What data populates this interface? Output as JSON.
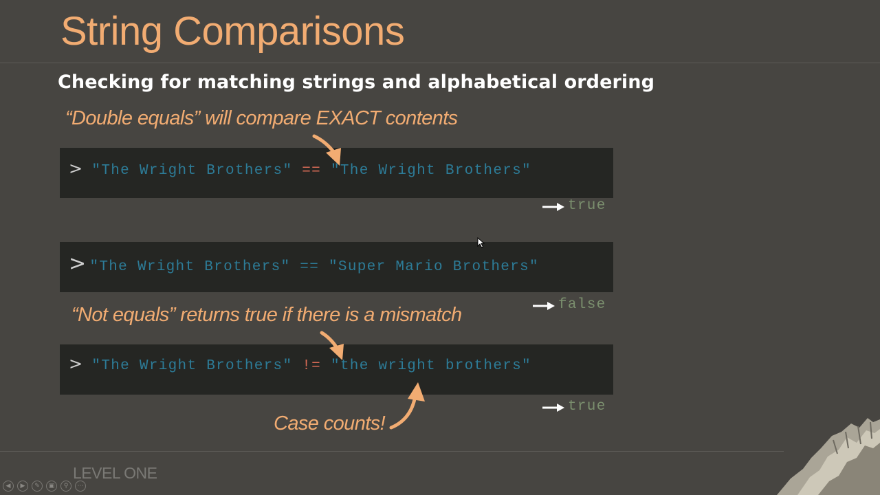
{
  "slide": {
    "title": "String Comparisons",
    "subtitle": "Checking for matching strings and alphabetical ordering",
    "footer_label": "LEVEL ONE",
    "accent_color": "#f2ac72",
    "background_color": "#474541",
    "code_background": "#252623"
  },
  "annotations": {
    "double_equals": "“Double equals” will compare EXACT contents",
    "not_equals": "“Not equals” returns true if there is a mismatch",
    "case_counts": "Case counts!"
  },
  "examples": [
    {
      "prompt": ">",
      "left": "\"The Wright Brothers\"",
      "operator": "==",
      "right": "\"The Wright Brothers\"",
      "result": "true"
    },
    {
      "prompt": ">",
      "left": "\"The Wright Brothers\"",
      "operator": "==",
      "right": "\"Super Mario Brothers\"",
      "result": "false"
    },
    {
      "prompt": ">",
      "left": "\"The Wright Brothers\"",
      "operator": "!=",
      "right": "\"the wright brothers\"",
      "result": "true"
    }
  ],
  "playback_controls": [
    {
      "icon": "previous-icon"
    },
    {
      "icon": "next-icon"
    },
    {
      "icon": "pen-icon"
    },
    {
      "icon": "slides-icon"
    },
    {
      "icon": "zoom-icon"
    },
    {
      "icon": "more-icon"
    }
  ]
}
